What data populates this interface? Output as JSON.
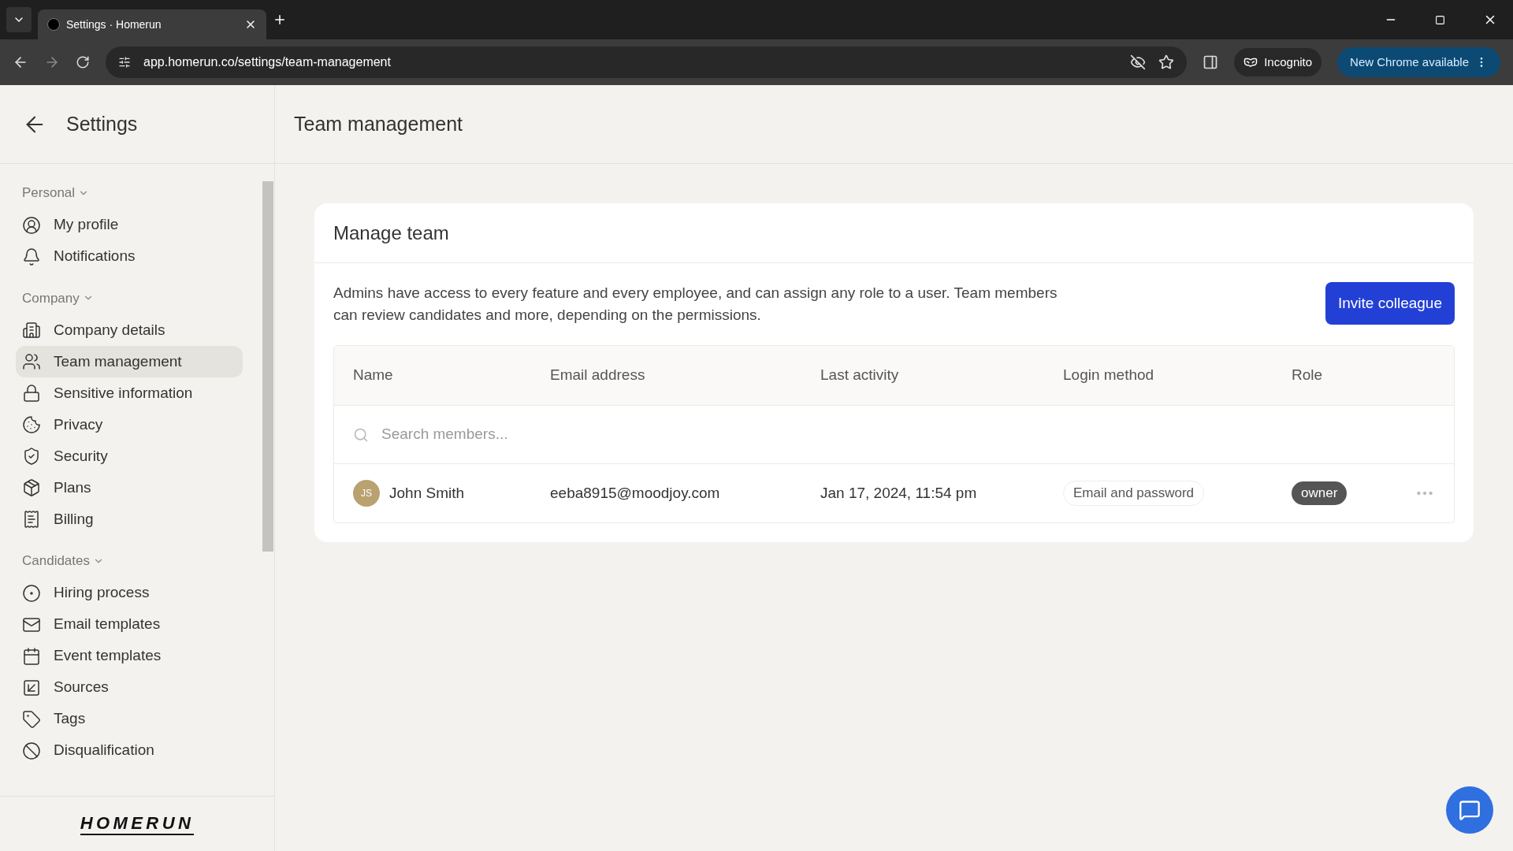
{
  "browser": {
    "tab_title": "Settings · Homerun",
    "url": "app.homerun.co/settings/team-management",
    "incognito_label": "Incognito",
    "update_button": "New Chrome available"
  },
  "sidebar": {
    "title": "Settings",
    "sections": [
      {
        "label": "Personal",
        "items": [
          {
            "label": "My profile",
            "selected": false
          },
          {
            "label": "Notifications",
            "selected": false
          }
        ]
      },
      {
        "label": "Company",
        "items": [
          {
            "label": "Company details",
            "selected": false
          },
          {
            "label": "Team management",
            "selected": true
          },
          {
            "label": "Sensitive information",
            "selected": false
          },
          {
            "label": "Privacy",
            "selected": false
          },
          {
            "label": "Security",
            "selected": false
          },
          {
            "label": "Plans",
            "selected": false
          },
          {
            "label": "Billing",
            "selected": false
          }
        ]
      },
      {
        "label": "Candidates",
        "items": [
          {
            "label": "Hiring process",
            "selected": false
          },
          {
            "label": "Email templates",
            "selected": false
          },
          {
            "label": "Event templates",
            "selected": false
          },
          {
            "label": "Sources",
            "selected": false
          },
          {
            "label": "Tags",
            "selected": false
          },
          {
            "label": "Disqualification",
            "selected": false
          }
        ]
      }
    ],
    "logo": "HOMERUN"
  },
  "page_title": "Team management",
  "card": {
    "title": "Manage team",
    "description": "Admins have access to every feature and every employee, and can assign any role to a user. Team members can review candidates and more, depending on the permissions.",
    "invite_button": "Invite colleague",
    "table": {
      "columns": [
        "Name",
        "Email address",
        "Last activity",
        "Login method",
        "Role"
      ],
      "search_placeholder": "Search members...",
      "rows": [
        {
          "initials": "JS",
          "name": "John Smith",
          "email": "eeba8915@moodjoy.com",
          "last_activity": "Jan 17, 2024, 11:54 pm",
          "login_method": "Email and password",
          "role": "owner"
        }
      ]
    }
  }
}
